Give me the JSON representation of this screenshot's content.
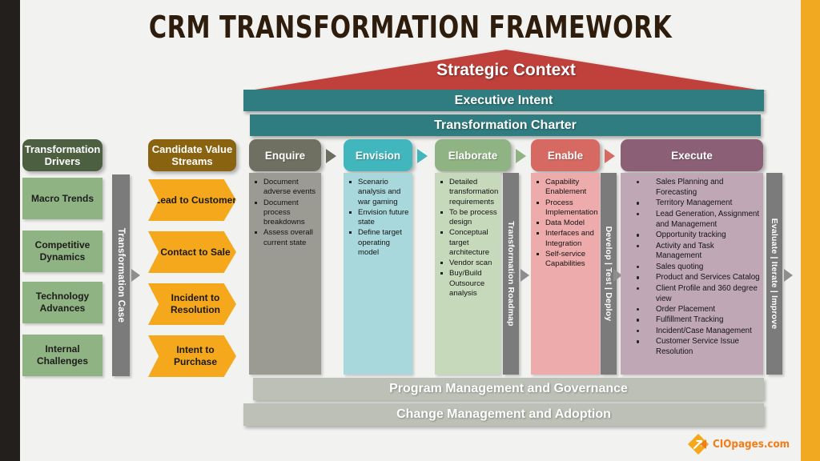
{
  "title": "CRM TRANSFORMATION FRAMEWORK",
  "colors": {
    "roof_red": "#c0413b",
    "teal": "#307d81",
    "left_edge": "#231f1c",
    "right_edge": "#f2a922",
    "driver_header": "#4c5f41",
    "driver_box": "#8fb382",
    "value_header": "#8a6310",
    "chevron": "#f5a81c",
    "enquire": "#6f7061",
    "envision": "#41b6bd",
    "elaborate": "#8fb382",
    "enable": "#d66a62",
    "execute": "#8b5f76",
    "spine_gray": "#7b7b7b",
    "bottom_bar": "#bcc0b6"
  },
  "roof": {
    "label": "Strategic Context"
  },
  "bars": {
    "executive_intent": "Executive Intent",
    "transformation_charter": "Transformation  Charter"
  },
  "drivers": {
    "header": "Transformation Drivers",
    "items": [
      {
        "label": "Macro Trends"
      },
      {
        "label": "Competitive Dynamics"
      },
      {
        "label": "Technology Advances"
      },
      {
        "label": "Internal Challenges"
      }
    ]
  },
  "spines": {
    "transformation_case": "Transformation Case",
    "transformation_roadmap": "Transformation Roadmap",
    "develop_test_deploy": "Develop | Test | Deploy",
    "evaluate_iterate_improve": "Evaluate | Iterate | Improve"
  },
  "value_streams": {
    "header": "Candidate Value Streams",
    "items": [
      {
        "label": "Lead to Customer"
      },
      {
        "label": "Contact to Sale"
      },
      {
        "label": "Incident to Resolution"
      },
      {
        "label": "Intent to Purchase"
      }
    ]
  },
  "phases": [
    {
      "name": "Enquire",
      "bullets": [
        "Document adverse events",
        "Document process breakdowns",
        "Assess overall current state"
      ]
    },
    {
      "name": "Envision",
      "bullets": [
        "Scenario analysis and war gaming",
        "Envision future state",
        "Define target operating model"
      ]
    },
    {
      "name": "Elaborate",
      "bullets": [
        "Detailed transformation requirements",
        "To be process design",
        "Conceptual target architecture",
        "Vendor scan",
        "Buy/Build Outsource analysis"
      ]
    },
    {
      "name": "Enable",
      "bullets": [
        "Capability Enablement",
        "Process Implementation",
        "Data Model",
        "Interfaces and Integration",
        "Self-service Capabilities"
      ]
    },
    {
      "name": "Execute",
      "bullets": [
        "Sales Planning and Forecasting",
        "Territory Management",
        "Lead Generation, Assignment and Management",
        "Opportunity tracking",
        "Activity and Task Management",
        "Sales quoting",
        "Product and Services Catalog",
        "Client Profile and 360 degree view",
        "Order Placement",
        "Fulfillment Tracking",
        "Incident/Case Management",
        "Customer Service Issue Resolution"
      ]
    }
  ],
  "bottom_bars": {
    "program": "Program  Management and Governance",
    "change": "Change  Management and Adoption"
  },
  "logo": {
    "text": "CIOpages.com",
    "mark": "ciopages-diamond-arrow-icon"
  }
}
